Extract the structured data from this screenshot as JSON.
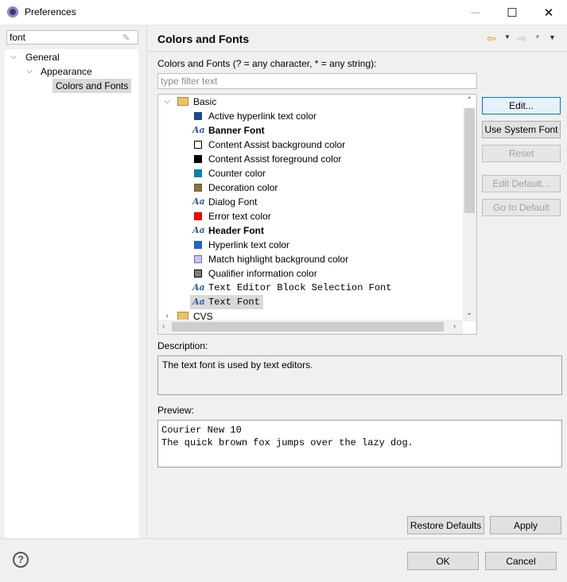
{
  "window": {
    "title": "Preferences",
    "minimize_glyph": "—",
    "maximize_glyph": "☐",
    "close_glyph": "✕"
  },
  "sidebar": {
    "filter_value": "font",
    "tree": [
      {
        "label": "General",
        "expanded": true,
        "level": 0
      },
      {
        "label": "Appearance",
        "expanded": true,
        "level": 1
      },
      {
        "label": "Colors and Fonts",
        "level": 2,
        "selected": true
      }
    ]
  },
  "page": {
    "title": "Colors and Fonts",
    "section_label": "Colors and Fonts (? = any character, * = any string):",
    "filter_placeholder": "type filter text",
    "tree": {
      "group": "Basic",
      "items": [
        {
          "label": "Active hyperlink text color",
          "kind": "color",
          "color": "#1a4a8a"
        },
        {
          "label": "Banner Font",
          "kind": "font",
          "bold": true
        },
        {
          "label": "Content Assist background color",
          "kind": "color",
          "color": "#ffffff"
        },
        {
          "label": "Content Assist foreground color",
          "kind": "color",
          "color": "#000000"
        },
        {
          "label": "Counter color",
          "kind": "color",
          "color": "#0f7fa8"
        },
        {
          "label": "Decoration color",
          "kind": "color",
          "color": "#8a7440"
        },
        {
          "label": "Dialog Font",
          "kind": "font"
        },
        {
          "label": "Error text color",
          "kind": "color",
          "color": "#ff0000"
        },
        {
          "label": "Header Font",
          "kind": "font",
          "bold": true
        },
        {
          "label": "Hyperlink text color",
          "kind": "color",
          "color": "#1e63d0"
        },
        {
          "label": "Match highlight background color",
          "kind": "color",
          "color": "#c8c8f0"
        },
        {
          "label": "Qualifier information color",
          "kind": "color",
          "color": "#808080"
        },
        {
          "label": "Text Editor Block Selection Font",
          "kind": "font",
          "mono": true
        },
        {
          "label": "Text Font",
          "kind": "font",
          "mono": true,
          "selected": true
        }
      ],
      "collapsed_group": "CVS"
    },
    "buttons": {
      "edit": "Edit...",
      "use_system_font": "Use System Font",
      "reset": "Reset",
      "edit_default": "Edit Default...",
      "go_to_default": "Go to Default"
    },
    "description_label": "Description:",
    "description": "The text font is used by text editors.",
    "preview_label": "Preview:",
    "preview_lines": [
      "Courier New 10",
      "The quick brown fox jumps over the lazy dog."
    ],
    "restore_defaults": "Restore Defaults",
    "apply": "Apply"
  },
  "footer": {
    "ok": "OK",
    "cancel": "Cancel"
  }
}
